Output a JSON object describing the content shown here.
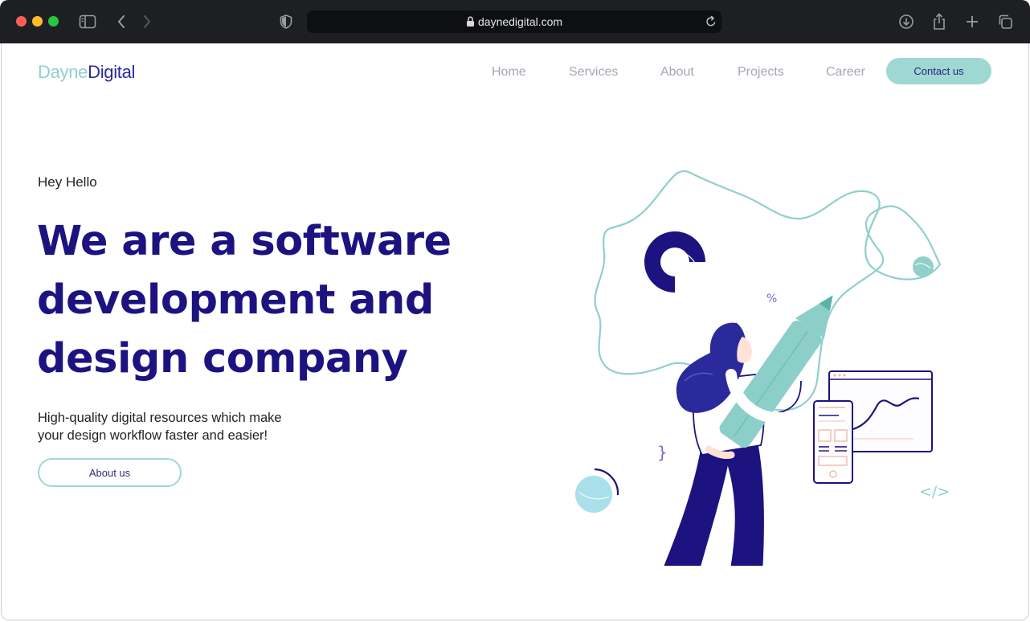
{
  "browser": {
    "url": "daynedigital.com",
    "icons": {
      "sidebar": "sidebar-icon",
      "back": "chevron-left-icon",
      "forward": "chevron-right-icon",
      "shield": "shield-icon",
      "lock": "lock-icon",
      "reload": "reload-icon",
      "download": "download-icon",
      "share": "share-icon",
      "new_tab": "plus-icon",
      "tabs": "tabs-icon"
    }
  },
  "site": {
    "logo_part1": "Dayne",
    "logo_part2": "Digital",
    "nav": [
      {
        "label": "Home"
      },
      {
        "label": "Services"
      },
      {
        "label": "About"
      },
      {
        "label": "Projects"
      },
      {
        "label": "Career"
      }
    ],
    "contact_label": "Contact us"
  },
  "hero": {
    "greeting": "Hey Hello",
    "headline": [
      "We are a software",
      "development and",
      "design company"
    ],
    "subtitle_line1": "High-quality digital resources which make",
    "subtitle_line2": "your design workflow faster and easier!",
    "about_label": "About us",
    "illustration_percent": "%",
    "illustration_code": "</>"
  },
  "colors": {
    "brand_dark": "#1c1380",
    "brand_teal": "#9fd7d3",
    "nav_gray": "#a6a6b4"
  }
}
